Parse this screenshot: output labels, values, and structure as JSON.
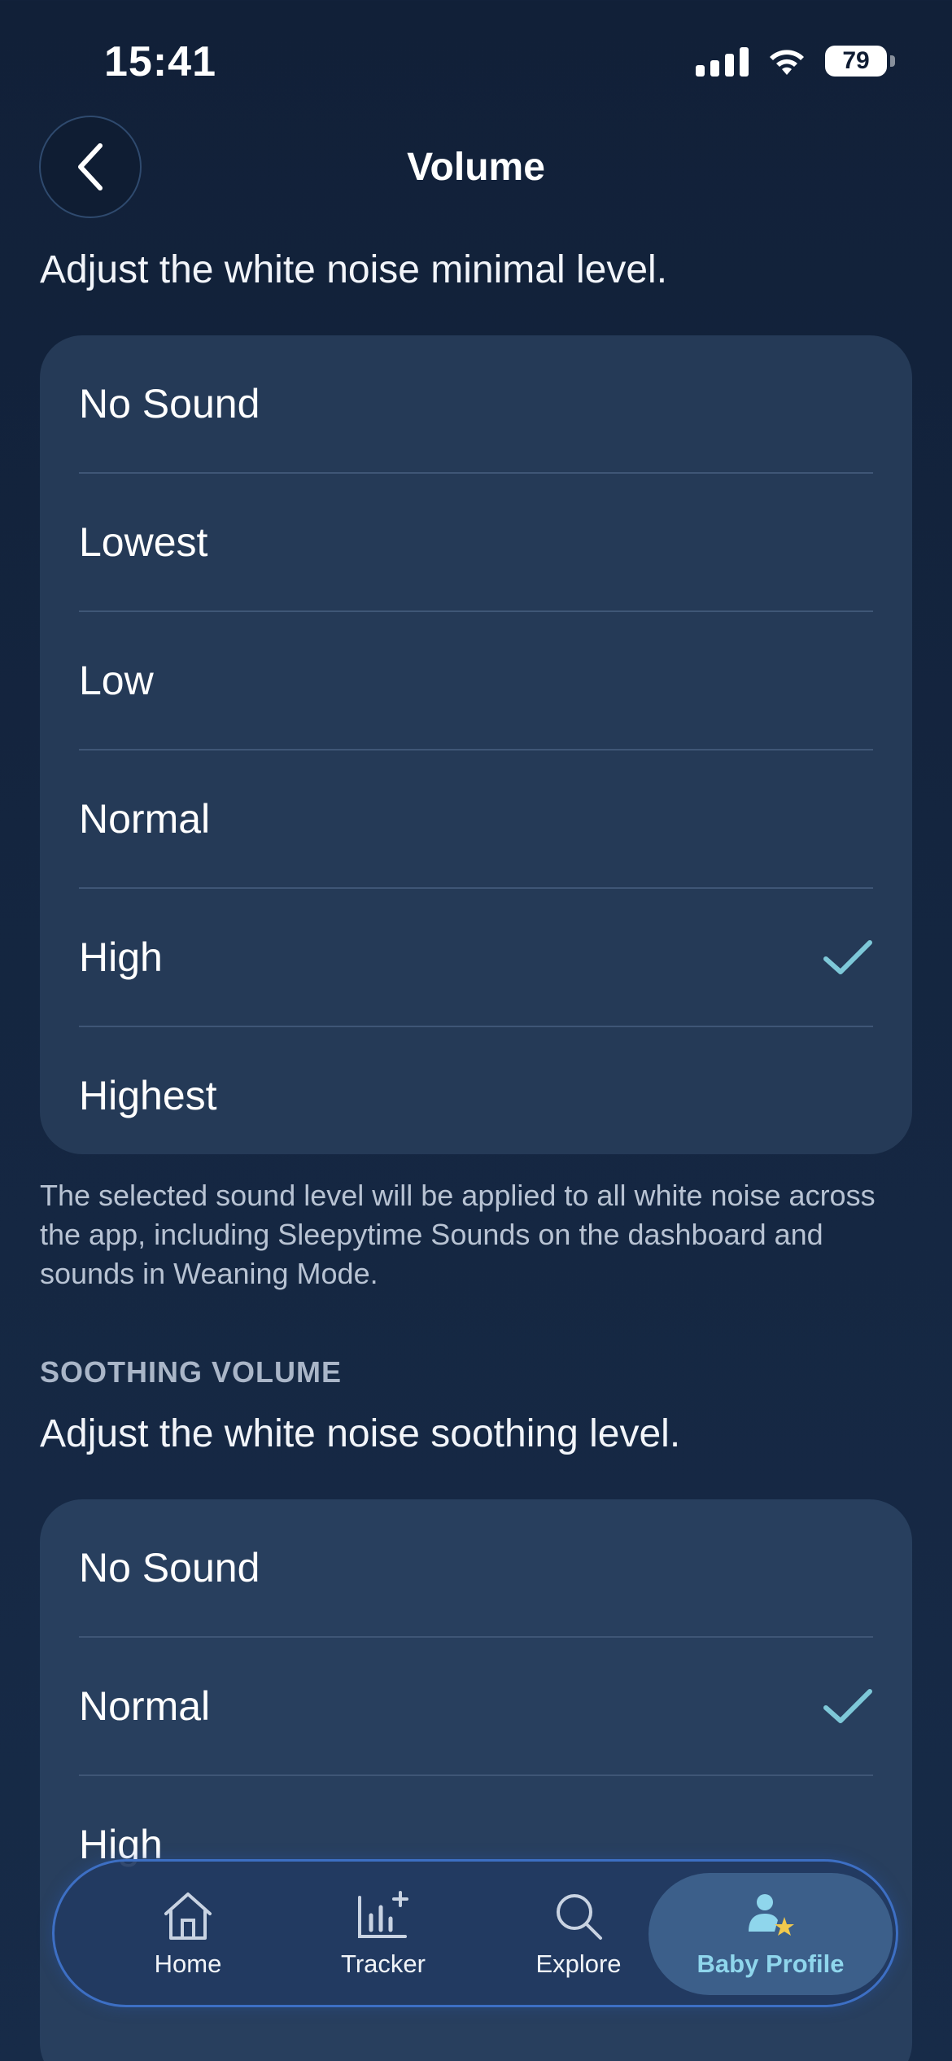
{
  "status_bar": {
    "time": "15:41",
    "battery": "79"
  },
  "header": {
    "title": "Volume",
    "back_icon": "chevron-left-icon"
  },
  "minimal": {
    "subtitle": "Adjust the white noise minimal level.",
    "options": [
      {
        "label": "No Sound",
        "selected": false
      },
      {
        "label": "Lowest",
        "selected": false
      },
      {
        "label": "Low",
        "selected": false
      },
      {
        "label": "Normal",
        "selected": false
      },
      {
        "label": "High",
        "selected": true
      },
      {
        "label": "Highest",
        "selected": false
      }
    ],
    "footnote": "The selected sound level will be applied to all white noise across the app, including Sleepytime Sounds on the dashboard and sounds in Weaning Mode."
  },
  "soothing": {
    "heading": "SOOTHING VOLUME",
    "subtitle": "Adjust the white noise soothing level.",
    "options": [
      {
        "label": "No Sound",
        "selected": false
      },
      {
        "label": "Normal",
        "selected": true
      },
      {
        "label": "High",
        "selected": false
      }
    ]
  },
  "tab_bar": {
    "items": [
      {
        "label": "Home",
        "icon": "home-icon",
        "active": false
      },
      {
        "label": "Tracker",
        "icon": "chart-add-icon",
        "active": false
      },
      {
        "label": "Explore",
        "icon": "search-icon",
        "active": false
      },
      {
        "label": "Baby Profile",
        "icon": "baby-profile-icon",
        "active": true
      }
    ]
  },
  "colors": {
    "background": "#14253f",
    "card": "#253a57",
    "check": "#7ec8d8",
    "active_tab_text": "#8fd6ec",
    "tab_bar_border": "#3d6fc4"
  }
}
